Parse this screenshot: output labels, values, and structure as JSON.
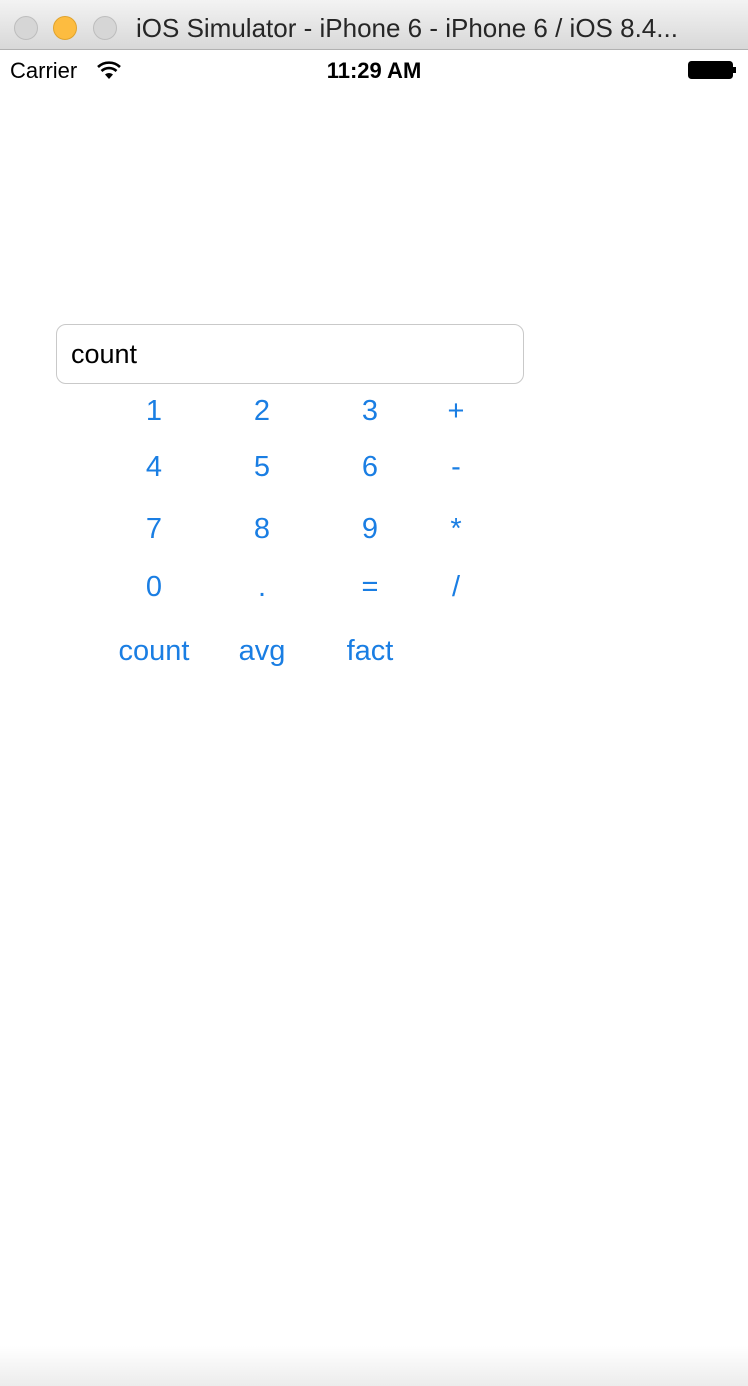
{
  "window": {
    "title": "iOS Simulator - iPhone 6 - iPhone 6 / iOS 8.4..."
  },
  "status_bar": {
    "carrier": "Carrier",
    "time": "11:29 AM"
  },
  "display": {
    "value": "count"
  },
  "keypad": {
    "row1": [
      "1",
      "2",
      "3",
      "+"
    ],
    "row2": [
      "4",
      "5",
      "6",
      "-"
    ],
    "row3": [
      "7",
      "8",
      "9",
      "*"
    ],
    "row4": [
      "0",
      ".",
      "=",
      "/"
    ],
    "functions": [
      "count",
      "avg",
      "fact"
    ]
  },
  "accent_color": "#1a7ee3"
}
